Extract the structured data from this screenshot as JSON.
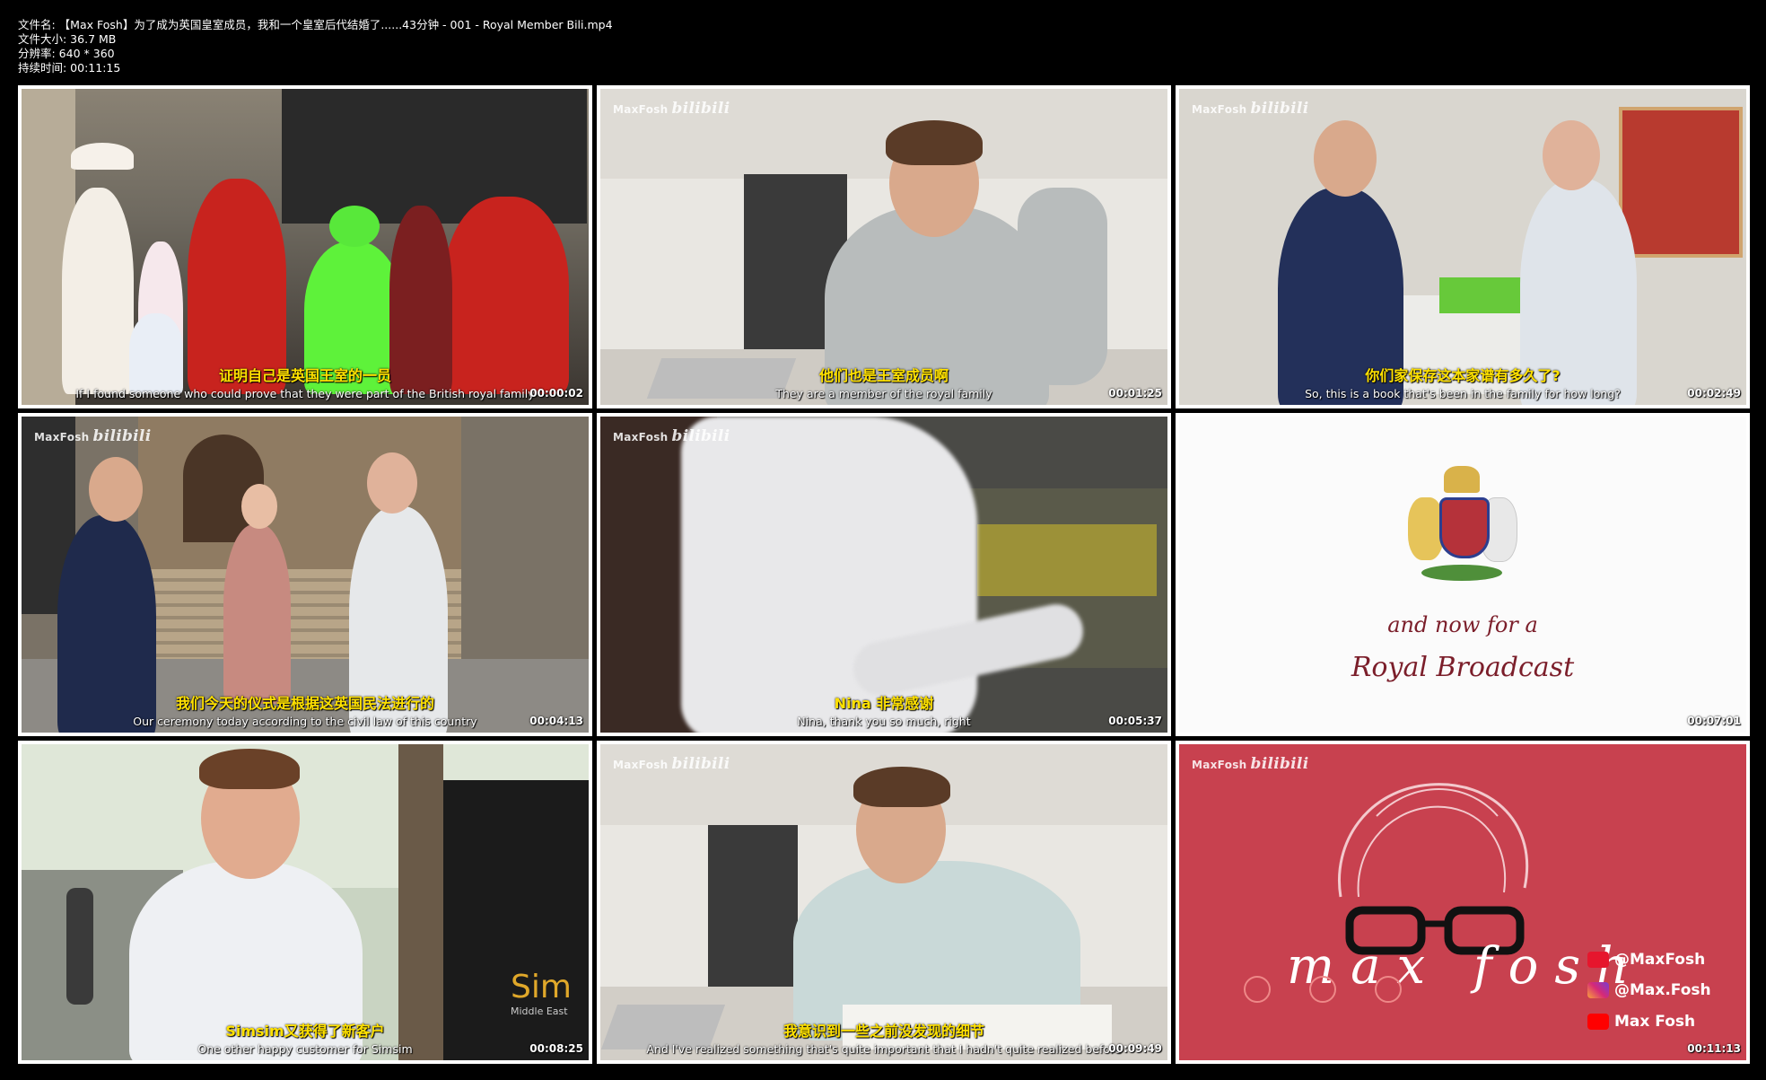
{
  "file_info": {
    "name": "文件名: 【Max Fosh】为了成为英国皇室成员，我和一个皇室后代结婚了......43分钟 - 001 - Royal Member Bili.mp4",
    "size": "文件大小: 36.7 MB",
    "resolution": "分辨率: 640 * 360",
    "duration": "持续时间: 00:11:15"
  },
  "watermark": {
    "brand": "MaxFosh",
    "site": "bilibili"
  },
  "thumbnails": [
    {
      "zh": "证明自己是英国王室的一员",
      "en": "If I found someone who could prove that they were part of the British royal family",
      "time": "00:00:02"
    },
    {
      "zh": "他们也是王室成员啊",
      "en": "They are a member of the royal family",
      "time": "00:01:25"
    },
    {
      "zh": "你们家保存这本家谱有多久了?",
      "en": "So, this is a book that's been in the family for how long?",
      "time": "00:02:49"
    },
    {
      "zh": "我们今天的仪式是根据这英国民法进行的",
      "en": "Our ceremony today according to the civil law of this country",
      "time": "00:04:13"
    },
    {
      "zh": "Nina 非常感谢",
      "en": "Nina, thank you so much, right",
      "time": "00:05:37"
    },
    {
      "time": "00:07:01",
      "line1": "and now for a",
      "line2": "Royal Broadcast"
    },
    {
      "zh": "Simsim又获得了新客户",
      "en": "One other happy customer for Simsim",
      "time": "00:08:25",
      "sign": "Sim",
      "sign2": "Middle East"
    },
    {
      "zh": "我意识到一些之前没发现的细节",
      "en": "And I've realized something that's quite important that I hadn't quite realized before",
      "time": "00:09:49"
    },
    {
      "time": "00:11:13",
      "logo": "max fosh",
      "weibo": "@MaxFosh",
      "instagram": "@Max.Fosh",
      "youtube": "Max Fosh"
    }
  ],
  "colors": {
    "subtitle_zh": "#ffe100",
    "card_red": "#c8414f",
    "queen_green": "#5ef23a"
  }
}
